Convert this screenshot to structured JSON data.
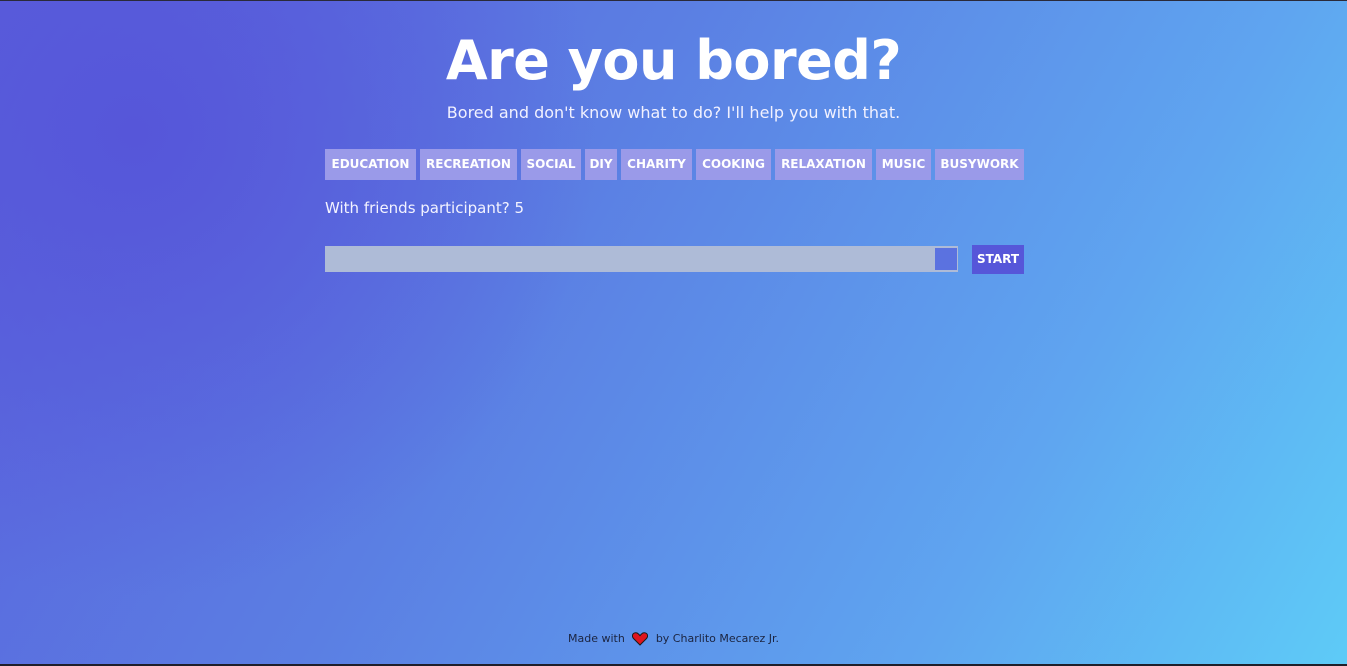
{
  "header": {
    "title": "Are you bored?",
    "subtitle": "Bored and don't know what to do? I'll help you with that."
  },
  "categories": [
    {
      "label": "EDUCATION"
    },
    {
      "label": "RECREATION"
    },
    {
      "label": "SOCIAL"
    },
    {
      "label": "DIY"
    },
    {
      "label": "CHARITY"
    },
    {
      "label": "COOKING"
    },
    {
      "label": "RELAXATION"
    },
    {
      "label": "MUSIC"
    },
    {
      "label": "BUSYWORK"
    }
  ],
  "participants": {
    "label": "With friends participant? 5",
    "value": 5,
    "slider_fraction": 1.0
  },
  "actions": {
    "start_label": "START"
  },
  "footer": {
    "prefix": "Made with",
    "icon": "heart-icon",
    "suffix": "by Charlito Mecarez Jr."
  },
  "colors": {
    "accent": "#5656d9",
    "category_bg": "#9a9ae9",
    "slider_track": "#aebbd7",
    "slider_thumb": "#5b72e0",
    "heart": "#e0141e"
  }
}
